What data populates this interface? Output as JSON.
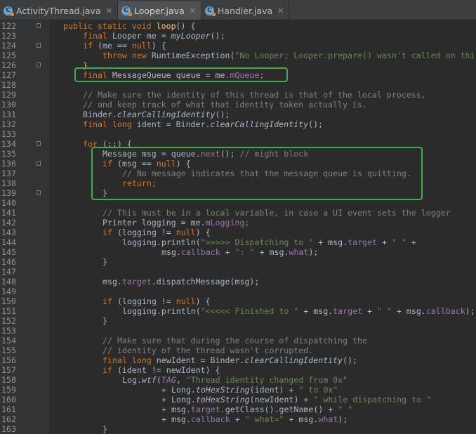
{
  "tabs": [
    {
      "label": "ActivityThread.java",
      "icon": "C",
      "active": false
    },
    {
      "label": "Looper.java",
      "icon": "C",
      "active": true
    },
    {
      "label": "Handler.java",
      "icon": "C",
      "active": false
    }
  ],
  "close_glyph": "✕",
  "lines": [
    {
      "n": "122",
      "ind": 4,
      "t": [
        [
          "kw",
          "public static void "
        ],
        [
          "fn",
          "loop"
        ],
        [
          "",
          "() {"
        ]
      ]
    },
    {
      "n": "123",
      "ind": 8,
      "t": [
        [
          "kw",
          "final "
        ],
        [
          "",
          "Looper me = "
        ],
        [
          "it",
          "myLooper"
        ],
        [
          "",
          "();"
        ]
      ]
    },
    {
      "n": "124",
      "ind": 8,
      "t": [
        [
          "kw",
          "if "
        ],
        [
          "",
          "(me == "
        ],
        [
          "kw",
          "null"
        ],
        [
          "",
          ") {"
        ]
      ]
    },
    {
      "n": "125",
      "ind": 12,
      "t": [
        [
          "kw",
          "throw new "
        ],
        [
          "",
          "RuntimeException("
        ],
        [
          "st",
          "\"No Looper; Looper.prepare() wasn't called on thi"
        ]
      ]
    },
    {
      "n": "126",
      "ind": 8,
      "t": [
        [
          "",
          "}"
        ]
      ]
    },
    {
      "n": "127",
      "ind": 8,
      "t": [
        [
          "kw",
          "final "
        ],
        [
          "",
          "MessageQueue queue = me."
        ],
        [
          "fd",
          "mQueue"
        ],
        [
          "kw",
          ";"
        ]
      ]
    },
    {
      "n": "128",
      "ind": 0,
      "t": []
    },
    {
      "n": "129",
      "ind": 8,
      "t": [
        [
          "cm",
          "// Make sure the identity of this thread is that of the local process,"
        ]
      ]
    },
    {
      "n": "130",
      "ind": 8,
      "t": [
        [
          "cm",
          "// and keep track of what that identity token actually is."
        ]
      ]
    },
    {
      "n": "131",
      "ind": 8,
      "t": [
        [
          "",
          "Binder."
        ],
        [
          "it",
          "clearCallingIdentity"
        ],
        [
          "",
          "();"
        ]
      ]
    },
    {
      "n": "132",
      "ind": 8,
      "t": [
        [
          "kw",
          "final long "
        ],
        [
          "",
          "ident = Binder."
        ],
        [
          "it",
          "clearCallingIdentity"
        ],
        [
          "",
          "();"
        ]
      ]
    },
    {
      "n": "133",
      "ind": 0,
      "t": []
    },
    {
      "n": "134",
      "ind": 8,
      "t": [
        [
          "kw",
          "for "
        ],
        [
          "",
          "(;;) {"
        ]
      ]
    },
    {
      "n": "135",
      "ind": 12,
      "t": [
        [
          "",
          "Message msg = queue."
        ],
        [
          "fd",
          "next"
        ],
        [
          "",
          "(); "
        ],
        [
          "cm",
          "// might block"
        ]
      ]
    },
    {
      "n": "136",
      "ind": 12,
      "t": [
        [
          "kw",
          "if "
        ],
        [
          "",
          "(msg == "
        ],
        [
          "kw",
          "null"
        ],
        [
          "",
          ") {"
        ]
      ]
    },
    {
      "n": "137",
      "ind": 16,
      "t": [
        [
          "cm",
          "// No message indicates that the message queue is quitting."
        ]
      ]
    },
    {
      "n": "138",
      "ind": 16,
      "t": [
        [
          "kw",
          "return;"
        ]
      ]
    },
    {
      "n": "139",
      "ind": 12,
      "t": [
        [
          "",
          "}"
        ]
      ]
    },
    {
      "n": "140",
      "ind": 0,
      "t": []
    },
    {
      "n": "141",
      "ind": 12,
      "t": [
        [
          "cm",
          "// This must be in a local variable, in case a UI event sets the logger"
        ]
      ]
    },
    {
      "n": "142",
      "ind": 12,
      "t": [
        [
          "",
          "Printer logging = me."
        ],
        [
          "fd",
          "mLogging"
        ],
        [
          "kw",
          ";"
        ]
      ]
    },
    {
      "n": "143",
      "ind": 12,
      "t": [
        [
          "kw",
          "if "
        ],
        [
          "",
          "(logging != "
        ],
        [
          "kw",
          "null"
        ],
        [
          "",
          ") {"
        ]
      ]
    },
    {
      "n": "144",
      "ind": 16,
      "t": [
        [
          "",
          "logging.println("
        ],
        [
          "st",
          "\">>>>> Dispatching to \" "
        ],
        [
          "",
          "+ msg."
        ],
        [
          "fd",
          "target"
        ],
        [
          "",
          " + "
        ],
        [
          "st",
          "\" \" "
        ],
        [
          "",
          "+"
        ]
      ]
    },
    {
      "n": "145",
      "ind": 24,
      "t": [
        [
          "",
          "msg."
        ],
        [
          "fd",
          "callback"
        ],
        [
          "",
          " + "
        ],
        [
          "st",
          "\": \" "
        ],
        [
          "",
          "+ msg."
        ],
        [
          "fd",
          "what"
        ],
        [
          "",
          ");"
        ]
      ]
    },
    {
      "n": "146",
      "ind": 12,
      "t": [
        [
          "",
          "}"
        ]
      ]
    },
    {
      "n": "147",
      "ind": 0,
      "t": []
    },
    {
      "n": "148",
      "ind": 12,
      "t": [
        [
          "",
          "msg."
        ],
        [
          "fd",
          "target"
        ],
        [
          "",
          ".dispatchMessage(msg);"
        ]
      ]
    },
    {
      "n": "149",
      "ind": 0,
      "t": []
    },
    {
      "n": "150",
      "ind": 12,
      "t": [
        [
          "kw",
          "if "
        ],
        [
          "",
          "(logging != "
        ],
        [
          "kw",
          "null"
        ],
        [
          "",
          ") {"
        ]
      ]
    },
    {
      "n": "151",
      "ind": 16,
      "t": [
        [
          "",
          "logging.println("
        ],
        [
          "st",
          "\"<<<<< Finished to \" "
        ],
        [
          "",
          "+ msg."
        ],
        [
          "fd",
          "target"
        ],
        [
          "",
          " + "
        ],
        [
          "st",
          "\" \" "
        ],
        [
          "",
          "+ msg."
        ],
        [
          "fd",
          "callback"
        ],
        [
          "",
          ");"
        ]
      ]
    },
    {
      "n": "152",
      "ind": 12,
      "t": [
        [
          "",
          "}"
        ]
      ]
    },
    {
      "n": "153",
      "ind": 0,
      "t": []
    },
    {
      "n": "154",
      "ind": 12,
      "t": [
        [
          "cm",
          "// Make sure that during the course of dispatching the"
        ]
      ]
    },
    {
      "n": "155",
      "ind": 12,
      "t": [
        [
          "cm",
          "// identity of the thread wasn't corrupted."
        ]
      ]
    },
    {
      "n": "156",
      "ind": 12,
      "t": [
        [
          "kw",
          "final long "
        ],
        [
          "",
          "newIdent = Binder."
        ],
        [
          "it",
          "clearCallingIdentity"
        ],
        [
          "",
          "();"
        ]
      ]
    },
    {
      "n": "157",
      "ind": 12,
      "t": [
        [
          "kw",
          "if "
        ],
        [
          "",
          "(ident != newIdent) {"
        ]
      ]
    },
    {
      "n": "158",
      "ind": 16,
      "t": [
        [
          "",
          "Log."
        ],
        [
          "it",
          "wtf"
        ],
        [
          "",
          "("
        ],
        [
          "ct",
          "TAG"
        ],
        [
          "",
          ", "
        ],
        [
          "st",
          "\"Thread identity changed from 0x\""
        ]
      ]
    },
    {
      "n": "159",
      "ind": 24,
      "t": [
        [
          "",
          "+ Long."
        ],
        [
          "it",
          "toHexString"
        ],
        [
          "",
          "(ident) + "
        ],
        [
          "st",
          "\" to 0x\""
        ]
      ]
    },
    {
      "n": "160",
      "ind": 24,
      "t": [
        [
          "",
          "+ Long."
        ],
        [
          "it",
          "toHexString"
        ],
        [
          "",
          "(newIdent) + "
        ],
        [
          "st",
          "\" while dispatching to \""
        ]
      ]
    },
    {
      "n": "161",
      "ind": 24,
      "t": [
        [
          "",
          "+ msg."
        ],
        [
          "fd",
          "target"
        ],
        [
          "",
          ".getClass().getName() + "
        ],
        [
          "st",
          "\" \""
        ]
      ]
    },
    {
      "n": "162",
      "ind": 24,
      "t": [
        [
          "",
          "+ msg."
        ],
        [
          "fd",
          "callback"
        ],
        [
          "",
          " + "
        ],
        [
          "st",
          "\" what=\" "
        ],
        [
          "",
          "+ msg."
        ],
        [
          "fd",
          "what"
        ],
        [
          "",
          ");"
        ]
      ]
    },
    {
      "n": "163",
      "ind": 12,
      "t": [
        [
          "",
          "}"
        ]
      ]
    }
  ],
  "fold_lines": [
    "122",
    "124",
    "126",
    "134",
    "136",
    "139"
  ],
  "colors": {
    "background": "#2b2b2b",
    "keyword": "#cc7832",
    "method_decl": "#ffc66d",
    "string": "#6a8759",
    "comment": "#808080",
    "field": "#9876aa",
    "highlight_box": "#3fae4a"
  }
}
